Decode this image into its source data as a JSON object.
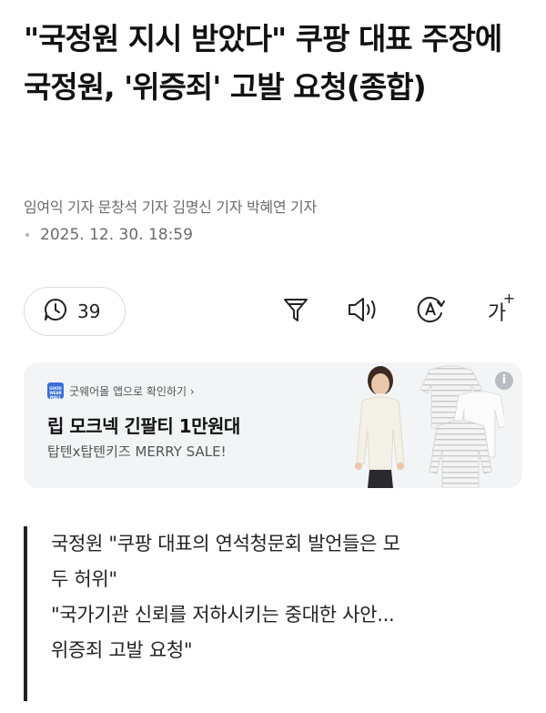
{
  "article": {
    "headline": "\"국정원 지시 받았다\" 쿠팡 대표 주장에 국정원, '위증죄' 고발 요청(종합)",
    "byline": "임여익 기자 문창석 기자 김명신 기자 박혜연 기자",
    "datetime": "2025. 12. 30. 18:59"
  },
  "toolbar": {
    "comment_count": "39",
    "font_size_glyph": "가",
    "font_size_plus": "+",
    "icons": {
      "comments": "comment-clock-icon",
      "filter": "filter-icon",
      "speaker": "speaker-icon",
      "translate": "translate-icon"
    }
  },
  "ad": {
    "source": "굿웨어몰 앱으로 확인하기 ›",
    "logo_text": "GOOD WEAR MALL",
    "title": "립 모크넥 긴팔티 1만원대",
    "subtitle": "탑텐x탑텐키즈 MERRY SALE!",
    "info_label": "i"
  },
  "summary": {
    "lines": [
      "국정원 \"쿠팡 대표의 연석청문회 발언들은 모",
      "두 허위\"",
      "\"국가기관 신뢰를 저하시키는 중대한 사안...",
      "위증죄 고발 요청\""
    ]
  },
  "colors": {
    "accent_logo": "#3a6fd8",
    "ad_background": "#f3f4f6",
    "meta_text": "#6b6b6b"
  }
}
